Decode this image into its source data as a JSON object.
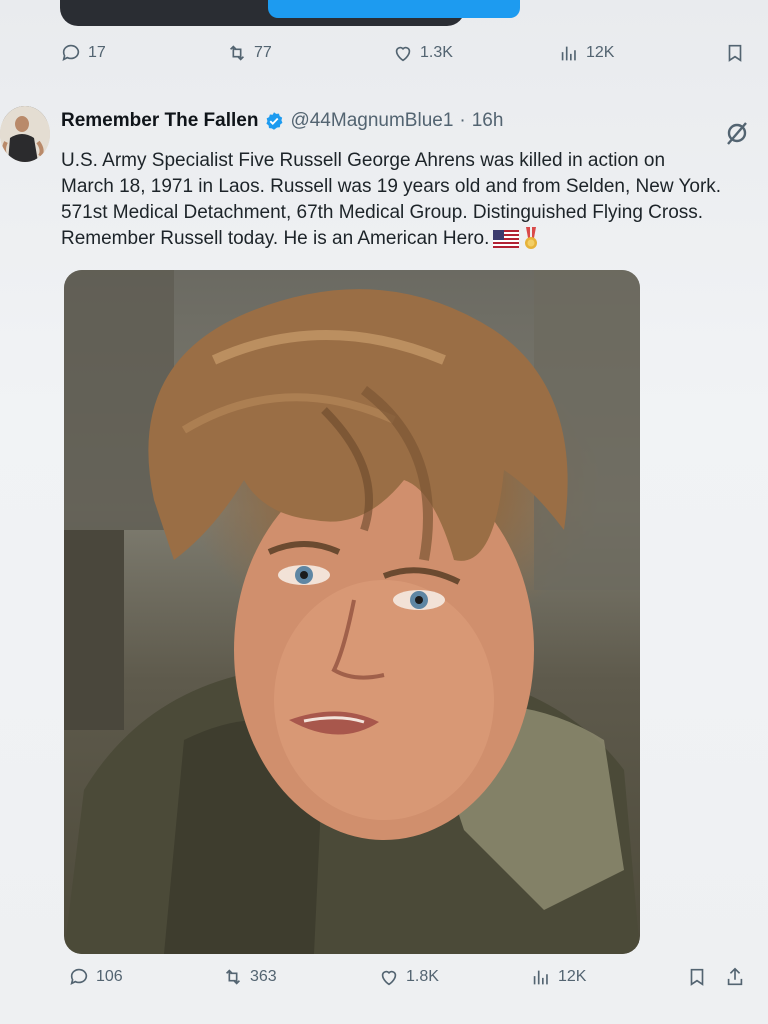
{
  "prev_tweet": {
    "stats": {
      "replies": "17",
      "reposts": "77",
      "likes": "1.3K",
      "views": "12K"
    }
  },
  "tweet": {
    "author_name": "Remember The Fallen",
    "handle": "@44MagnumBlue1",
    "separator": "·",
    "time": "16h",
    "text_lines": [
      "U.S. Army Specialist Five Russell George Ahrens was killed in action on",
      "March 18, 1971 in Laos. Russell was 19 years old and from Selden, New York.",
      "571st Medical Detachment, 67th Medical Group. Distinguished Flying Cross.",
      "Remember Russell today. He is an American Hero."
    ],
    "emojis": [
      "us-flag-icon",
      "medal-icon"
    ],
    "stats": {
      "replies": "106",
      "reposts": "363",
      "likes": "1.8K",
      "views": "12K"
    }
  },
  "colors": {
    "text": "#0f1419",
    "muted": "#536471",
    "accent": "#1d9bf0"
  }
}
